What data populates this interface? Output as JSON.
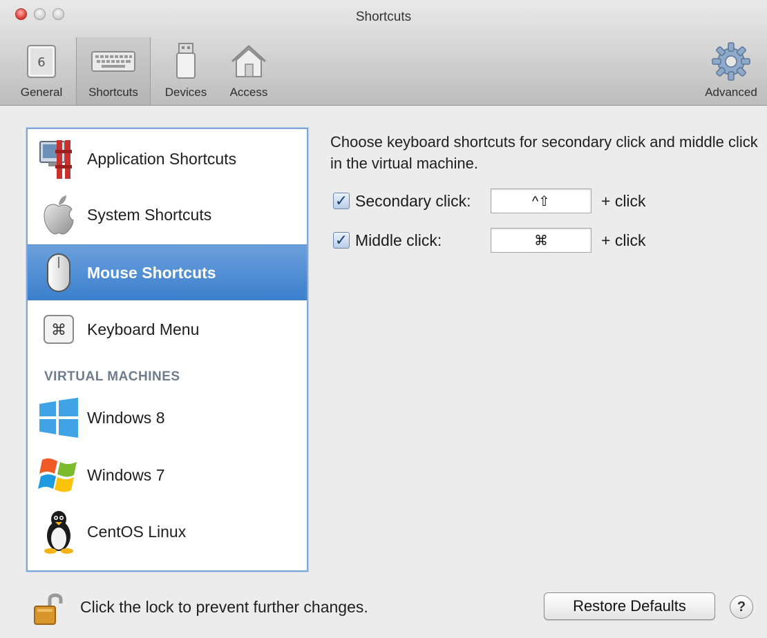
{
  "window": {
    "title": "Shortcuts"
  },
  "toolbar": {
    "items": [
      {
        "label": "General",
        "icon": "general-switch-icon",
        "selected": false
      },
      {
        "label": "Shortcuts",
        "icon": "keyboard-icon",
        "selected": true
      },
      {
        "label": "Devices",
        "icon": "usb-device-icon",
        "selected": false
      },
      {
        "label": "Access",
        "icon": "house-icon",
        "selected": false
      },
      {
        "label": "Advanced",
        "icon": "gear-icon",
        "selected": false
      }
    ]
  },
  "sidebar": {
    "items": [
      {
        "label": "Application Shortcuts",
        "icon": "application-shortcuts-icon",
        "selected": false
      },
      {
        "label": "System Shortcuts",
        "icon": "apple-icon",
        "selected": false
      },
      {
        "label": "Mouse Shortcuts",
        "icon": "mouse-icon",
        "selected": true
      },
      {
        "label": "Keyboard Menu",
        "icon": "command-key-icon",
        "selected": false
      }
    ],
    "section_header": "VIRTUAL MACHINES",
    "vms": [
      {
        "label": "Windows 8",
        "icon": "windows-8-icon"
      },
      {
        "label": "Windows 7",
        "icon": "windows-7-icon"
      },
      {
        "label": "CentOS Linux",
        "icon": "linux-penguin-icon"
      }
    ]
  },
  "main": {
    "description": "Choose keyboard shortcuts for secondary click and middle click in the virtual machine.",
    "options": [
      {
        "label": "Secondary click:",
        "checked": true,
        "shortcut": "^⇧",
        "suffix": "+ click"
      },
      {
        "label": "Middle click:",
        "checked": true,
        "shortcut": "⌘",
        "suffix": "+ click"
      }
    ]
  },
  "footer": {
    "lock_text": "Click the lock to prevent further changes.",
    "restore_label": "Restore Defaults",
    "help_label": "?"
  },
  "colors": {
    "selection": "#3b7fcc",
    "list_border": "#7ea6d8"
  }
}
